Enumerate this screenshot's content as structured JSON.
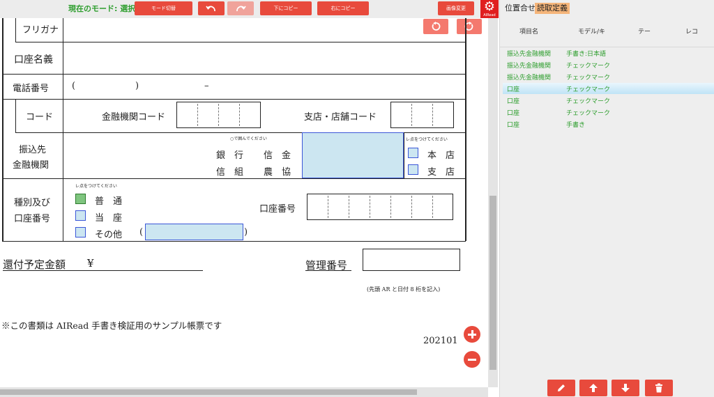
{
  "toolbar": {
    "mode_label": "現在のモード: 選択",
    "mode_toggle": "モード切替",
    "copy_down": "下にコピー",
    "copy_right": "右にコピー",
    "image_change": "画像変更",
    "brand": "AIRead",
    "gear_icon": "gear-icon"
  },
  "form": {
    "furigana": "フリガナ",
    "account_name": "口座名義",
    "phone_label": "電話番号",
    "phone_open": "(",
    "phone_close": ")",
    "phone_dash": "–",
    "code_label": "コード",
    "bank_code_label": "金融機関コード",
    "branch_code_label": "支店・店舗コード",
    "bank_label_1": "振込先",
    "bank_label_2": "金融機関",
    "circle_note": "○で囲んでください",
    "bank_types": [
      "銀　行",
      "信　金",
      "信　組",
      "農　協"
    ],
    "check_note": "レ点をつけてください",
    "branch_options": [
      "本　店",
      "支　店"
    ],
    "type_label_1": "種別及び",
    "type_label_2": "口座番号",
    "type_check_note": "レ点をつけてください",
    "account_types": [
      "普　通",
      "当　座",
      "その他"
    ],
    "other_open": "(",
    "other_close": ")",
    "account_number_label": "口座番号",
    "refund_label": "還付予定金額",
    "yen": "¥",
    "mgmt_label": "管理番号",
    "mgmt_note": "(先頭 AR と日付 8 桁を記入)",
    "sample_note": "※この書類は AIRead 手書き検証用のサンプル帳票です",
    "form_code": "202101"
  },
  "panel": {
    "tabs": [
      "位置合せ",
      "読取定義"
    ],
    "active_tab": "読取定義",
    "columns": [
      "項目名",
      "モデル/キ",
      "テー",
      "レコ"
    ],
    "rows": [
      {
        "name": "振込先金融機関",
        "model": "手書き:日本語"
      },
      {
        "name": "振込先金融機関",
        "model": "チェックマーク"
      },
      {
        "name": "振込先金融機関",
        "model": "チェックマーク"
      },
      {
        "name": "口座",
        "model": "チェックマーク"
      },
      {
        "name": "口座",
        "model": "チェックマーク"
      },
      {
        "name": "口座",
        "model": "チェックマーク"
      },
      {
        "name": "口座",
        "model": "手書き"
      }
    ],
    "selected_row": 3
  },
  "colors": {
    "accent_red": "#e84a3c",
    "mode_green": "#2e9e2e",
    "field_blue": "#cce6f1",
    "tab_orange": "#f5b57a"
  }
}
